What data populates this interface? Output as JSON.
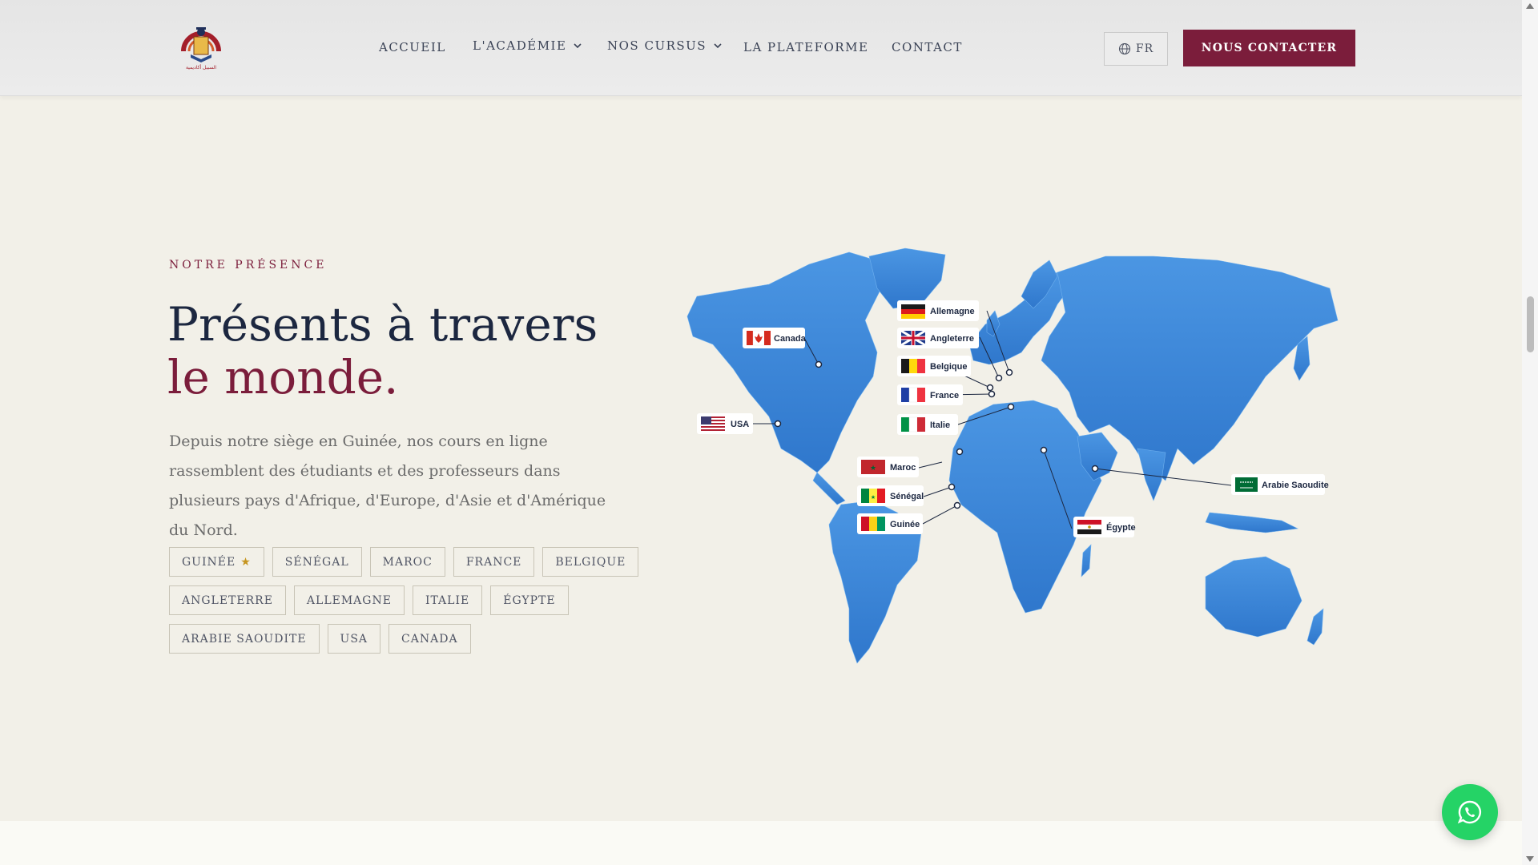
{
  "header": {
    "logo_caption": "السبيل أكاديمية",
    "nav": [
      {
        "label": "ACCUEIL",
        "has_dropdown": false
      },
      {
        "label": "L'ACADÉMIE",
        "has_dropdown": true
      },
      {
        "label": "NOS CURSUS",
        "has_dropdown": true
      },
      {
        "label": "LA PLATEFORME",
        "has_dropdown": false
      },
      {
        "label": "CONTACT",
        "has_dropdown": false
      }
    ],
    "language": "FR",
    "cta_label": "NOUS CONTACTER",
    "accent_color": "#7b1d3b"
  },
  "hero": {
    "eyebrow": "NOTRE PRÉSENCE",
    "title_line1": "Présents à travers",
    "title_line2": "le monde.",
    "description": "Depuis notre siège en Guinée, nos cours en ligne rassemblent des étudiants et des professeurs dans plusieurs pays d'Afrique, d'Europe, d'Asie et d'Amérique du Nord.",
    "tags": [
      [
        "GUINÉE",
        "SÉNÉGAL",
        "MAROC",
        "FRANCE",
        "BELGIQUE"
      ],
      [
        "ANGLETERRE",
        "ALLEMAGNE",
        "ITALIE",
        "ÉGYPTE"
      ],
      [
        "ARABIE SAOUDITE",
        "USA",
        "CANADA"
      ]
    ],
    "headquarters_tag": "GUINÉE"
  },
  "map": {
    "labels": {
      "allemagne": "Allemagne",
      "angleterre": "Angleterre",
      "belgique": "Belgique",
      "france": "France",
      "italie": "Italie",
      "canada": "Canada",
      "usa": "USA",
      "maroc": "Maroc",
      "senegal": "Sénégal",
      "guinee": "Guinée",
      "egypte": "Égypte",
      "arabie": "Arabie Saoudite"
    },
    "map_color": "#3b84d6"
  },
  "widgets": {
    "whatsapp_icon": "whatsapp-icon"
  }
}
